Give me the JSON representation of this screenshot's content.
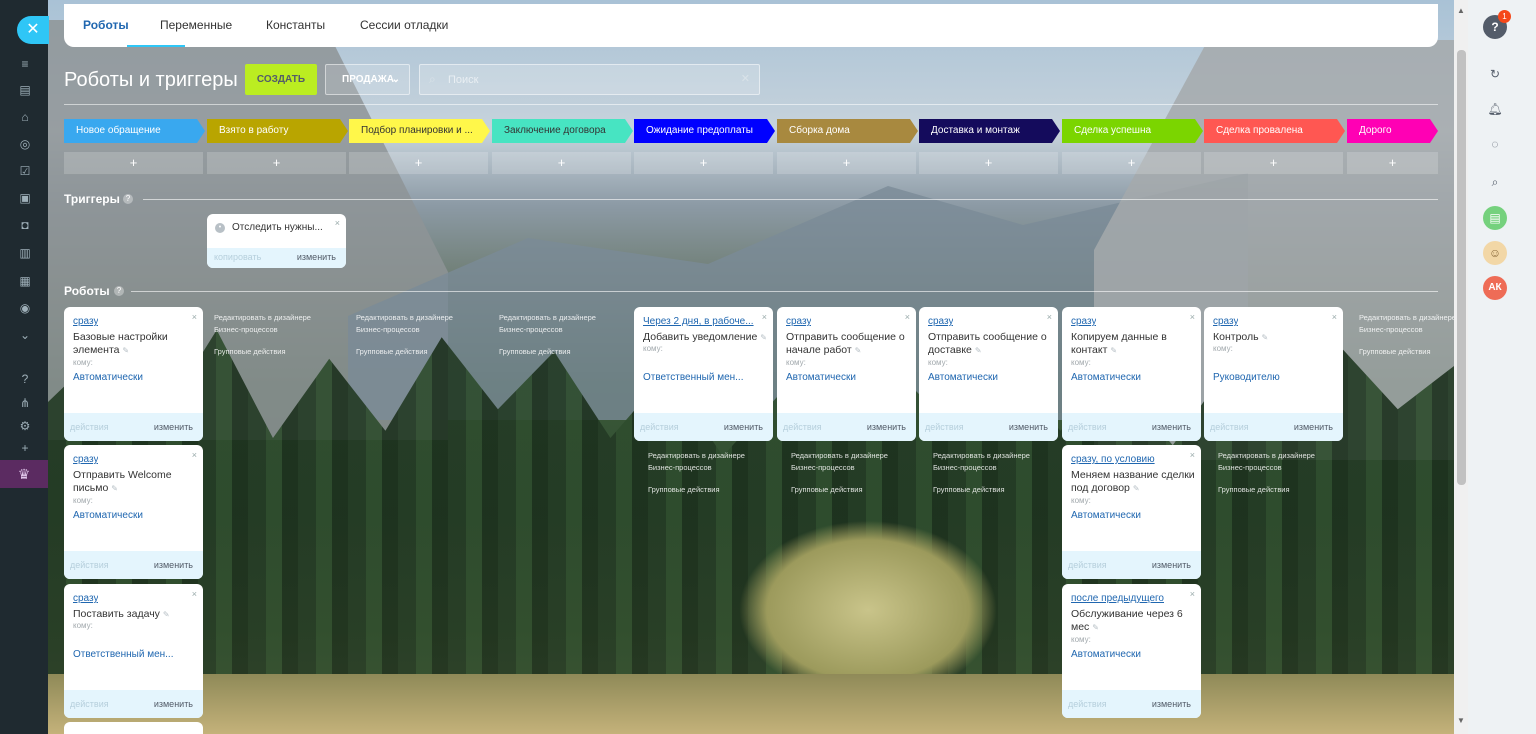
{
  "tabs": [
    {
      "label": "Роботы"
    },
    {
      "label": "Переменные"
    },
    {
      "label": "Константы"
    },
    {
      "label": "Сессии отладки"
    }
  ],
  "title": "Роботы и триггеры",
  "create_button": "СОЗДАТЬ",
  "pipeline_select": "ПРОДАЖА",
  "search": {
    "placeholder": "Поиск"
  },
  "stages": [
    {
      "label": "Новое обращение",
      "color": "#39a8ef",
      "text_color": "#ffffff"
    },
    {
      "label": "Взято в работу",
      "color": "#b9a500",
      "text_color": "#ffffff"
    },
    {
      "label": "Подбор планировки и ...",
      "color": "#fff74a",
      "text_color": "#333333"
    },
    {
      "label": "Заключение договора",
      "color": "#47e4c2",
      "text_color": "#333333"
    },
    {
      "label": "Ожидание предоплаты",
      "color": "#0000ff",
      "text_color": "#ffffff"
    },
    {
      "label": "Сборка дома",
      "color": "#a8893f",
      "text_color": "#ffffff"
    },
    {
      "label": "Доставка и монтаж",
      "color": "#140b5c",
      "text_color": "#ffffff"
    },
    {
      "label": "Сделка успешна",
      "color": "#7bd500",
      "text_color": "#ffffff"
    },
    {
      "label": "Сделка провалена",
      "color": "#ff5752",
      "text_color": "#ffffff"
    },
    {
      "label": "Дорого",
      "color": "#ff00b4",
      "text_color": "#ffffff"
    }
  ],
  "stage_add_symbol": "+",
  "triggers_section": "Триггеры",
  "robots_section": "Роботы",
  "trigger_card": {
    "name": "Отследить нужны...",
    "copy": "копировать",
    "edit": "изменить"
  },
  "card_common": {
    "to_label": "кому:",
    "actions": "действия",
    "edit": "изменить",
    "close": "×"
  },
  "links": {
    "designer": "Редактировать в дизайнере Бизнес-процессов",
    "group": "Групповые действия"
  },
  "robots": [
    {
      "when": "сразу",
      "name": "Базовые настройки элемента",
      "to": "Автоматически"
    },
    {
      "when": "сразу",
      "name": "Отправить Welcome письмо",
      "to": "Автоматически"
    },
    {
      "when": "сразу",
      "name": "Поставить задачу",
      "to": "Ответственный мен..."
    },
    {
      "when": "Через 2 дня, в рабоче...",
      "name": "Добавить уведомление",
      "to": "Ответственный мен..."
    },
    {
      "when": "сразу",
      "name": "Отправить сообщение о начале работ",
      "to": "Автоматически"
    },
    {
      "when": "сразу",
      "name": "Отправить сообщение о доставке",
      "to": "Автоматически"
    },
    {
      "when": "сразу",
      "name": "Копируем данные в контакт",
      "to": "Автоматически"
    },
    {
      "when": "сразу, по условию",
      "name": "Меняем название сделки под договор",
      "to": "Автоматически"
    },
    {
      "when": "после предыдущего",
      "name": "Обслуживание через 6 мес",
      "to": "Автоматически"
    },
    {
      "when": "сразу",
      "name": "Контроль",
      "to": "Руководителю"
    }
  ],
  "rightbar": {
    "notification_count": "1",
    "avatar_initials": "АК"
  },
  "colors": {
    "accent": "#2fc6f6",
    "create": "#bbed21",
    "link": "#2067b0"
  }
}
